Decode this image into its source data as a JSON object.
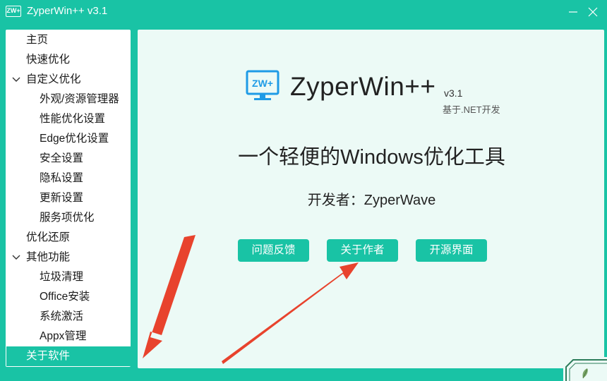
{
  "window": {
    "title": "ZyperWin++ v3.1",
    "icon_text": "ZW+",
    "minimize_glyph": "—",
    "close_glyph": "✕",
    "accent_color": "#19c3a5"
  },
  "sidebar": {
    "items": [
      {
        "label": "主页",
        "level": 0
      },
      {
        "label": "快速优化",
        "level": 0
      },
      {
        "label": "自定义优化",
        "level": 0,
        "expanded": true
      },
      {
        "label": "外观/资源管理器",
        "level": 1
      },
      {
        "label": "性能优化设置",
        "level": 1
      },
      {
        "label": "Edge优化设置",
        "level": 1
      },
      {
        "label": "安全设置",
        "level": 1
      },
      {
        "label": "隐私设置",
        "level": 1
      },
      {
        "label": "更新设置",
        "level": 1
      },
      {
        "label": "服务项优化",
        "level": 1
      },
      {
        "label": "优化还原",
        "level": 0
      },
      {
        "label": "其他功能",
        "level": 0,
        "expanded": true
      },
      {
        "label": "垃圾清理",
        "level": 1
      },
      {
        "label": "Office安装",
        "level": 1
      },
      {
        "label": "系统激活",
        "level": 1
      },
      {
        "label": "Appx管理",
        "level": 1
      },
      {
        "label": "关于软件",
        "level": 0,
        "selected": true
      }
    ]
  },
  "about": {
    "logo_text": "ZW+",
    "app_name": "ZyperWin++",
    "version": "v3.1",
    "based_on": "基于.NET开发",
    "tagline": "一个轻便的Windows优化工具",
    "developer": "开发者：ZyperWave",
    "buttons": {
      "feedback": "问题反馈",
      "author": "关于作者",
      "source": "开源界面"
    }
  },
  "annotations": {
    "arrow_color": "#e8432d"
  }
}
